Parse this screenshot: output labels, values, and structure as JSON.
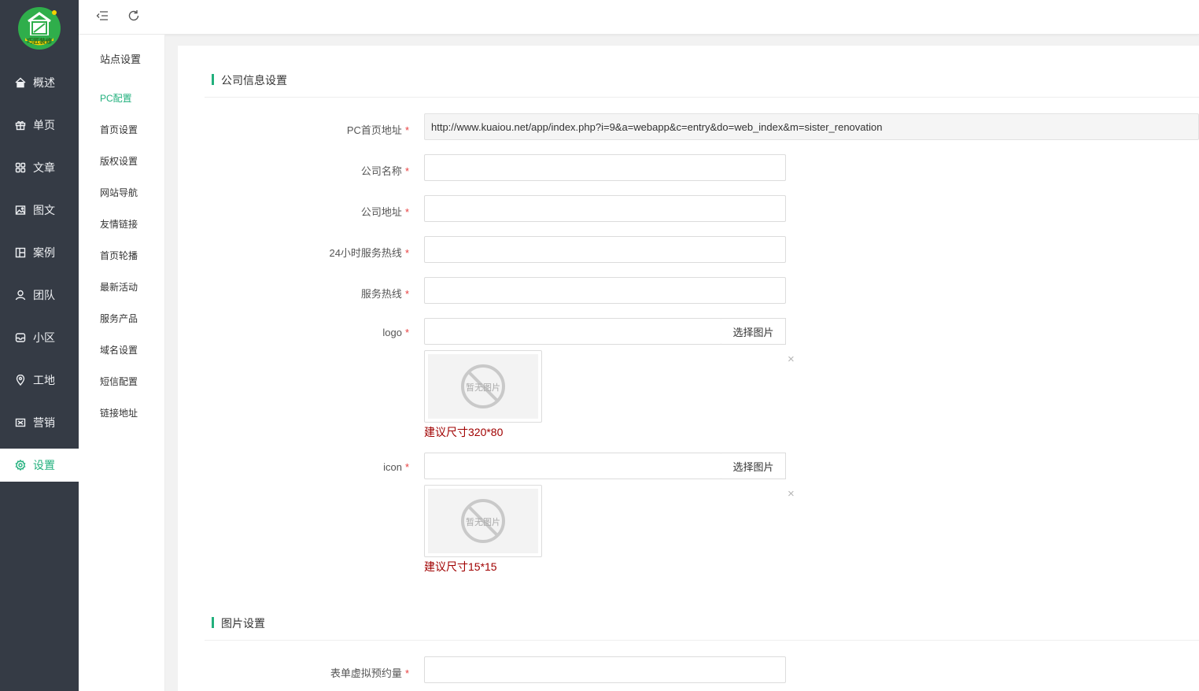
{
  "brand": {
    "logo_text": "巧匠装修",
    "accent": "#22b07d"
  },
  "nav": {
    "items": [
      {
        "label": "概述",
        "icon": "home-icon"
      },
      {
        "label": "单页",
        "icon": "gift-icon"
      },
      {
        "label": "文章",
        "icon": "grid-icon"
      },
      {
        "label": "图文",
        "icon": "image-icon"
      },
      {
        "label": "案例",
        "icon": "layout-icon"
      },
      {
        "label": "团队",
        "icon": "user-icon"
      },
      {
        "label": "小区",
        "icon": "inbox-icon"
      },
      {
        "label": "工地",
        "icon": "location-icon"
      },
      {
        "label": "营销",
        "icon": "marketing-icon"
      },
      {
        "label": "设置",
        "icon": "gear-icon"
      }
    ],
    "active": "设置"
  },
  "subnav": {
    "title": "站点设置",
    "items": [
      "PC配置",
      "首页设置",
      "版权设置",
      "网站导航",
      "友情链接",
      "首页轮播",
      "最新活动",
      "服务产品",
      "域名设置",
      "短信配置",
      "链接地址"
    ],
    "active": "PC配置"
  },
  "sections": {
    "company": {
      "title": "公司信息设置",
      "fields": {
        "pc_url": {
          "label": "PC首页地址",
          "value": "http://www.kuaiou.net/app/index.php?i=9&a=webapp&c=entry&do=web_index&m=sister_renovation"
        },
        "company_name": {
          "label": "公司名称",
          "value": ""
        },
        "company_address": {
          "label": "公司地址",
          "value": ""
        },
        "hotline_24h": {
          "label": "24小时服务热线",
          "value": ""
        },
        "hotline": {
          "label": "服务热线",
          "value": ""
        },
        "logo": {
          "label": "logo",
          "value": "",
          "button": "选择图片",
          "placeholder_img": "暂无图片",
          "hint": "建议尺寸320*80"
        },
        "icon": {
          "label": "icon",
          "value": "",
          "button": "选择图片",
          "placeholder_img": "暂无图片",
          "hint": "建议尺寸15*15"
        }
      }
    },
    "image": {
      "title": "图片设置",
      "fields": {
        "form_virtual": {
          "label": "表单虚拟预约量",
          "value": ""
        }
      }
    }
  },
  "required_mark": "*",
  "close_glyph": "×"
}
